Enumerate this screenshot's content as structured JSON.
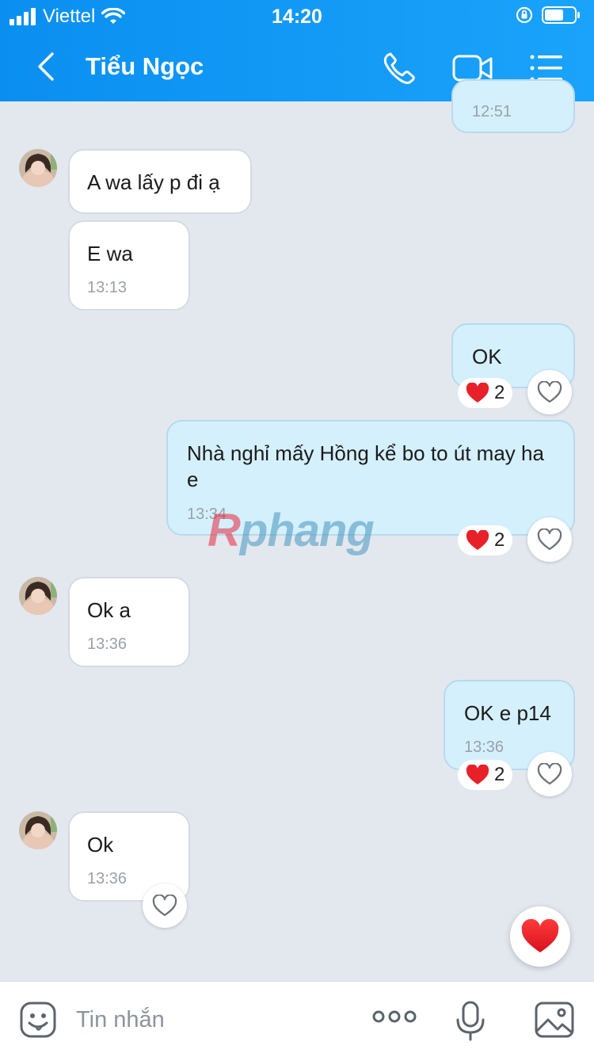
{
  "status_bar": {
    "carrier": "Viettel",
    "time": "14:20"
  },
  "header": {
    "title": "Tiểu Ngọc"
  },
  "messages": [
    {
      "sender": "me",
      "time": "12:51"
    },
    {
      "sender": "them",
      "text": "A wa lấy p đi ạ"
    },
    {
      "sender": "them",
      "text": "E wa",
      "time": "13:13"
    },
    {
      "sender": "me",
      "text": "OK",
      "reaction_count": "2"
    },
    {
      "sender": "me",
      "text": "Nhà nghỉ mấy Hồng kể bo to út may ha e",
      "time": "13:34",
      "reaction_count": "2"
    },
    {
      "sender": "them",
      "text": "Ok a",
      "time": "13:36"
    },
    {
      "sender": "me",
      "text": "OK e p14",
      "time": "13:36",
      "reaction_count": "2"
    },
    {
      "sender": "them",
      "text": "Ok",
      "time": "13:36"
    }
  ],
  "watermark": {
    "first": "R",
    "rest": "phang"
  },
  "composer": {
    "placeholder": "Tin nhắn"
  },
  "colors": {
    "header_bg": "#0a8ff0",
    "my_bubble": "#d4f0fd",
    "their_bubble": "#ffffff",
    "chat_bg": "#e3e8ef",
    "heart": "#e8202a"
  }
}
